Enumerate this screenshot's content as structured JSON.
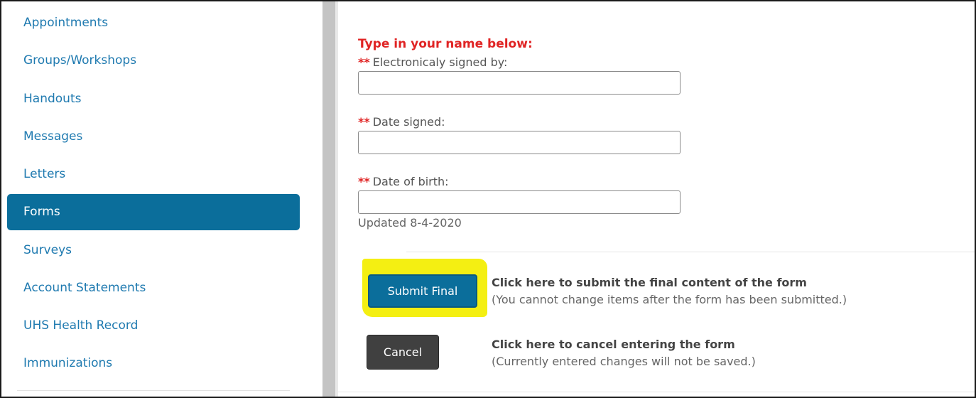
{
  "sidebar": {
    "items": [
      {
        "label": "Appointments"
      },
      {
        "label": "Groups/Workshops"
      },
      {
        "label": "Handouts"
      },
      {
        "label": "Messages"
      },
      {
        "label": "Letters"
      },
      {
        "label": "Forms",
        "active": true
      },
      {
        "label": "Surveys"
      },
      {
        "label": "Account Statements"
      },
      {
        "label": "UHS Health Record"
      },
      {
        "label": "Immunizations"
      }
    ]
  },
  "form": {
    "heading": "Type in your name below:",
    "required_marker": "**",
    "fields": [
      {
        "label": "Electronicaly signed by:",
        "value": ""
      },
      {
        "label": "Date signed:",
        "value": ""
      },
      {
        "label": "Date of birth:",
        "value": ""
      }
    ],
    "updated_note": "Updated 8-4-2020"
  },
  "actions": {
    "submit": {
      "label": "Submit Final",
      "title": "Click here to submit the final content of the form",
      "note": "(You cannot change items after the form has been submitted.)"
    },
    "cancel": {
      "label": "Cancel",
      "title": "Click here to cancel entering the form",
      "note": "(Currently entered changes will not be saved.)"
    }
  },
  "colors": {
    "accent": "#0b6e9b",
    "link": "#1f7ab0",
    "required": "#e02424",
    "highlight": "#f4ef12",
    "cancel_button": "#404040"
  }
}
